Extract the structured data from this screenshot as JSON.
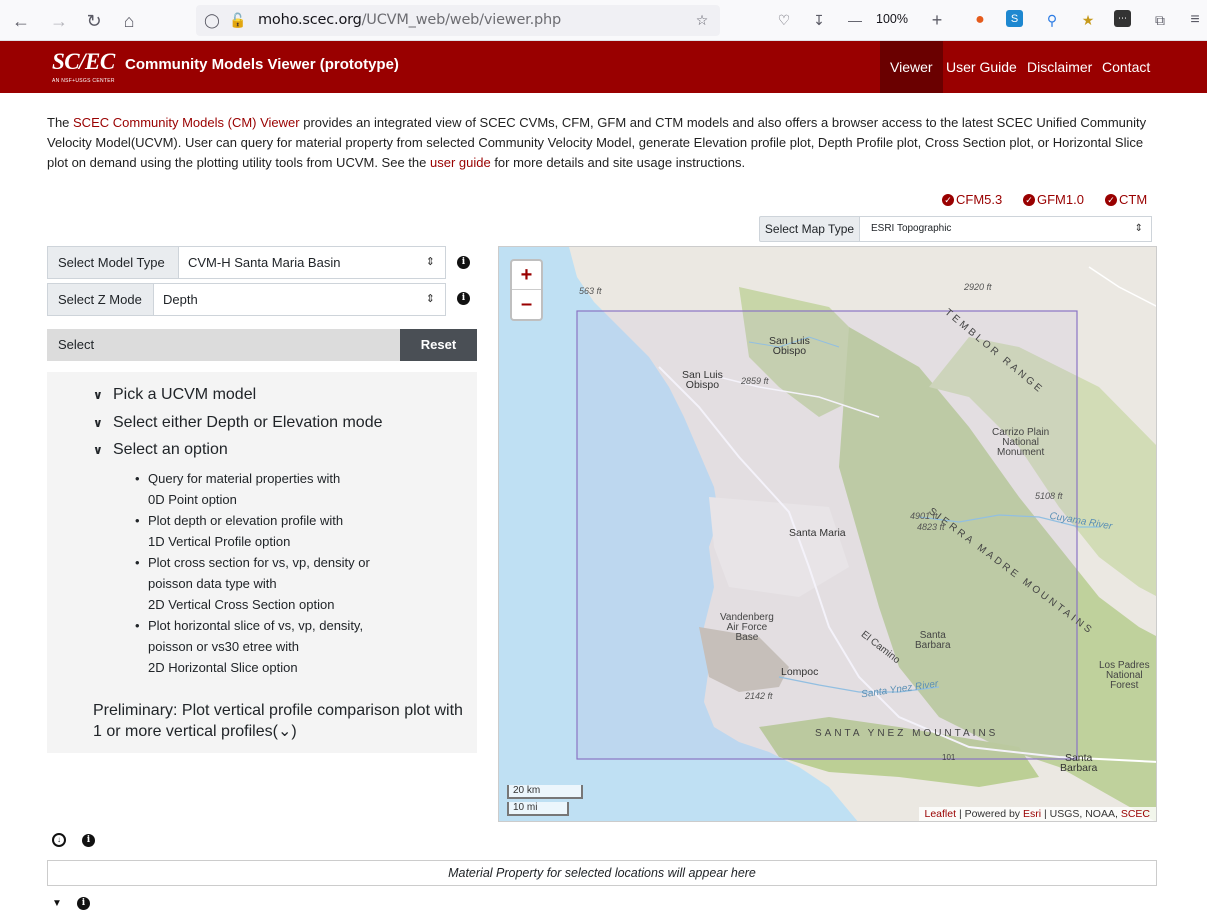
{
  "browser": {
    "url_host": "moho.scec.org",
    "url_path": "/UCVM_web/web/viewer.php",
    "zoom": "100%"
  },
  "header": {
    "logo": "SC/EC",
    "logo_sub": "AN NSF+USGS CENTER",
    "title": "Community Models Viewer (prototype)",
    "nav": [
      "Viewer",
      "User Guide",
      "Disclaimer",
      "Contact"
    ]
  },
  "intro": {
    "p1": "The ",
    "link1": "SCEC Community Models (CM) Viewer",
    "p2": " provides an integrated view of SCEC CVMs, CFM, GFM and CTM models and also offers a browser access to the latest SCEC Unified Community Velocity Model(UCVM). User can query for material property from selected Community Velocity Model, generate Elevation profile plot, Depth Profile plot, Cross Section plot, or Horizontal Slice plot on demand using the plotting utility tools from UCVM. See the ",
    "link2": "user guide",
    "p3": " for more details and site usage instructions."
  },
  "toggles": [
    "CFM5.3",
    "GFM1.0",
    "CTM"
  ],
  "map_type": {
    "label": "Select Map Type",
    "value": "ESRI Topographic"
  },
  "controls": {
    "model_label": "Select Model Type",
    "model_value": "CVM-H Santa Maria Basin",
    "zmode_label": "Select Z Mode",
    "zmode_value": "Depth",
    "select_label": "Select",
    "reset_label": "Reset"
  },
  "instructions": {
    "steps": [
      "Pick a UCVM model",
      "Select either Depth or Elevation mode",
      "Select an option"
    ],
    "options": [
      [
        "Query for material properties with",
        "0D Point option"
      ],
      [
        "Plot depth or elevation profile with",
        "1D Vertical Profile option"
      ],
      [
        "Plot cross section for vs, vp, density or",
        "poisson data type with",
        "2D Vertical Cross Section option"
      ],
      [
        "Plot horizontal slice of vs, vp, density,",
        "poisson or vs30 etree with",
        "2D Horizontal Slice option"
      ]
    ],
    "prelim": "Preliminary: Plot vertical profile comparison plot with 1 or more vertical profiles(⌄)"
  },
  "map": {
    "zoom_in": "+",
    "zoom_out": "–",
    "scale_km": "20 km",
    "scale_mi": "10 mi",
    "attribution": {
      "leaflet": "Leaflet",
      "powered": " | Powered by ",
      "esri": "Esri",
      "rest": " | USGS, NOAA, ",
      "scec": "SCEC"
    },
    "labels": {
      "slo1": "San Luis",
      "slo2": "Obispo",
      "slo_city1": "San Luis",
      "slo_city2": "Obispo",
      "santa_maria": "Santa Maria",
      "lompoc": "Lompoc",
      "vandenberg1": "Vandenberg",
      "vandenberg2": "Air Force",
      "vandenberg3": "Base",
      "carrizo1": "Carrizo Plain",
      "carrizo2": "National",
      "carrizo3": "Monument",
      "sb1": "Santa",
      "sb2": "Barbara",
      "sbcity1": "Santa",
      "sbcity2": "Barbara",
      "lospadres1": "Los Padres",
      "lospadres2": "National",
      "lospadres3": "Forest",
      "temblor": "TEMBLOR RANGE",
      "sierra": "SIERRA MADRE MOUNTAINS",
      "santaynez": "SANTA YNEZ MOUNTAINS",
      "cuyama": "Cuyama River",
      "syriver": "Santa Ynez River",
      "elcamino": "El Camino",
      "e563": "563 ft",
      "e2920": "2920 ft",
      "e2859": "2859 ft",
      "e5108": "5108 ft",
      "e4901": "4901 ft",
      "e4823": "4823 ft",
      "e2142": "2142 ft",
      "hw101": "101"
    }
  },
  "bottom": {
    "material_text": "Material Property for selected locations will appear here"
  }
}
